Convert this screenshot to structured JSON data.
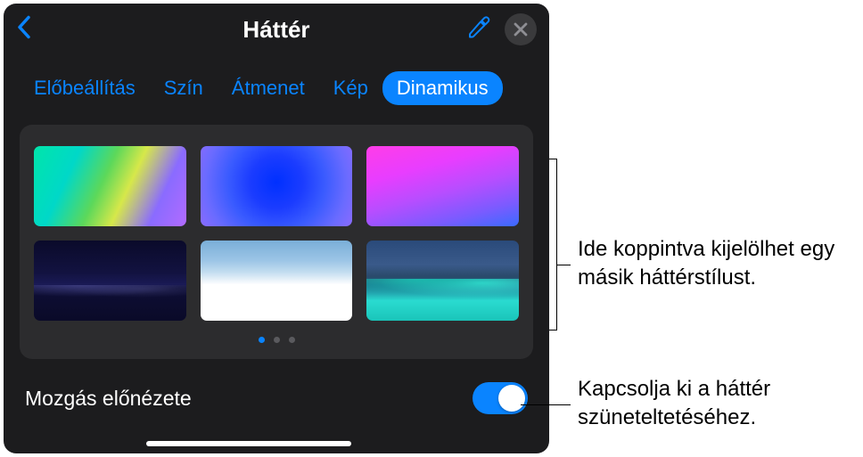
{
  "header": {
    "title": "Háttér"
  },
  "tabs": {
    "items": [
      {
        "label": "Előbeállítás",
        "active": false
      },
      {
        "label": "Szín",
        "active": false
      },
      {
        "label": "Átmenet",
        "active": false
      },
      {
        "label": "Kép",
        "active": false
      },
      {
        "label": "Dinamikus",
        "active": true
      }
    ]
  },
  "pagination": {
    "count": 3,
    "active_index": 0
  },
  "motion": {
    "label": "Mozgás előnézete",
    "enabled": true
  },
  "callouts": {
    "styles": "Ide koppintva kijelölhet egy másik háttérstílust.",
    "toggle": "Kapcsolja ki a háttér szüneteltetéséhez."
  }
}
